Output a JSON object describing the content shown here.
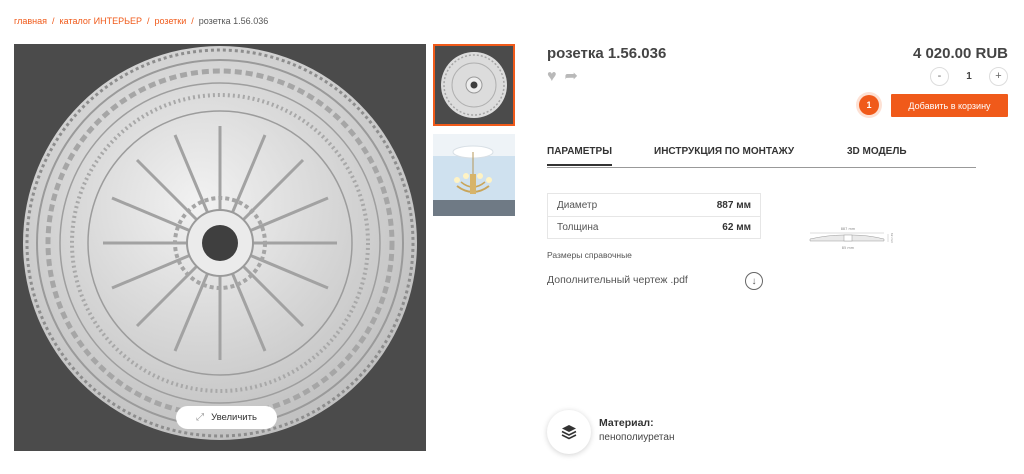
{
  "breadcrumb": {
    "home": "главная",
    "catalog": "каталог ИНТЕРЬЕР",
    "category": "розетки",
    "current": "розетка 1.56.036",
    "separator": "/"
  },
  "gallery": {
    "zoom_label": "Увеличить",
    "zoom_icon": "expand-icon"
  },
  "product": {
    "title": "розетка 1.56.036",
    "price": "4 020.00 RUB",
    "quantity": "1",
    "minus": "-",
    "plus": "+",
    "cart_count": "1",
    "add_to_cart": "Добавить в корзину",
    "accent_color": "#f05a1a"
  },
  "tabs": [
    {
      "label": "ПАРАМЕТРЫ",
      "active": true
    },
    {
      "label": "ИНСТРУКЦИЯ ПО МОНТАЖУ",
      "active": false
    },
    {
      "label": "3D МОДЕЛЬ",
      "active": false
    }
  ],
  "params": [
    {
      "name": "Диаметр",
      "value": "887 мм"
    },
    {
      "name": "Толщина",
      "value": "62 мм"
    }
  ],
  "drawing": {
    "top_dim": "887 mm",
    "bottom_dim": "85 mm",
    "side_dim": "62 mm"
  },
  "note": "Размеры справочные",
  "pdf_label": "Дополнительный чертеж .pdf",
  "material": {
    "label": "Материал:",
    "value": "пенополиуретан"
  }
}
